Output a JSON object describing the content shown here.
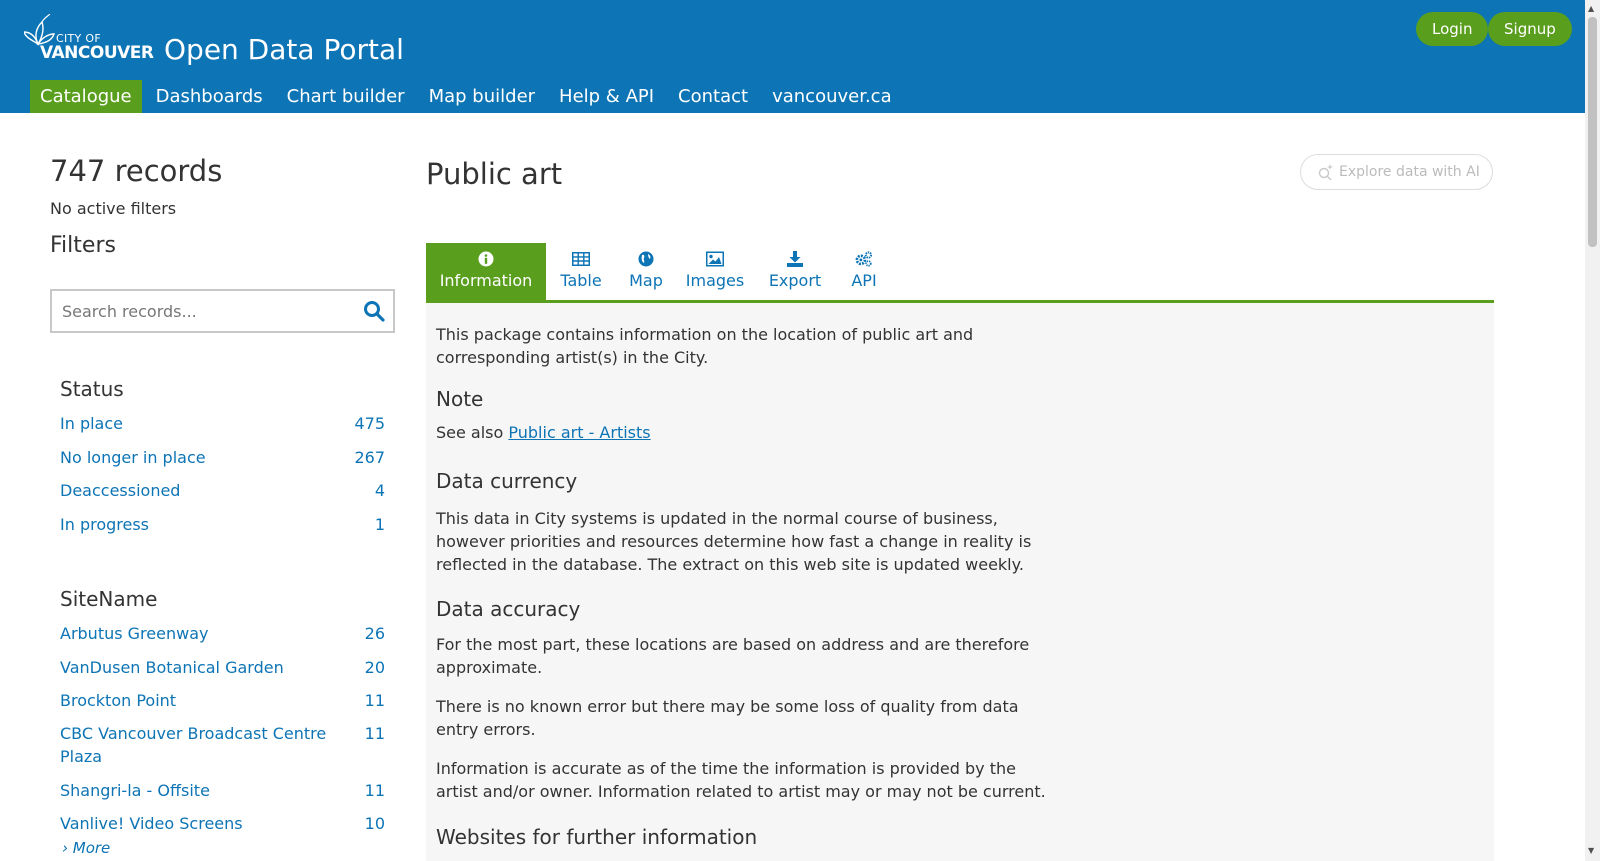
{
  "header": {
    "logo_small": "CITY OF",
    "logo_big": "VANCOUVER",
    "site_title": "Open Data Portal",
    "login": "Login",
    "signup": "Signup",
    "nav": [
      "Catalogue",
      "Dashboards",
      "Chart builder",
      "Map builder",
      "Help & API",
      "Contact",
      "vancouver.ca"
    ]
  },
  "sidebar": {
    "records": "747 records",
    "active_filters": "No active filters",
    "filters_title": "Filters",
    "search_placeholder": "Search records...",
    "status": {
      "title": "Status",
      "items": [
        {
          "label": "In place",
          "count": "475"
        },
        {
          "label": "No longer in place",
          "count": "267"
        },
        {
          "label": "Deaccessioned",
          "count": "4"
        },
        {
          "label": "In progress",
          "count": "1"
        }
      ]
    },
    "sitename": {
      "title": "SiteName",
      "items": [
        {
          "label": "Arbutus Greenway",
          "count": "26"
        },
        {
          "label": "VanDusen Botanical Garden",
          "count": "20"
        },
        {
          "label": "Brockton Point",
          "count": "11"
        },
        {
          "label": "CBC Vancouver Broadcast Centre Plaza",
          "count": "11"
        },
        {
          "label": "Shangri-la - Offsite",
          "count": "11"
        },
        {
          "label": "Vanlive! Video Screens",
          "count": "10"
        }
      ],
      "more": "› More"
    }
  },
  "main": {
    "title": "Public art",
    "ai_button": "Explore data with AI",
    "tabs": [
      "Information",
      "Table",
      "Map",
      "Images",
      "Export",
      "API"
    ],
    "intro": "This package contains information on the location of public art and corresponding artist(s) in the City.",
    "note_title": "Note",
    "note_prefix": "See also ",
    "note_link": "Public art - Artists",
    "currency_title": "Data currency",
    "currency_text": "This data in City systems is updated in the normal course of business, however priorities and resources determine how fast a change in reality is reflected in the database. The extract on this web site is updated weekly.",
    "accuracy_title": "Data accuracy",
    "accuracy_p1": "For the most part, these locations are based on address and are therefore approximate.",
    "accuracy_p2": "There is no known error but there may be some loss of quality from data entry errors.",
    "accuracy_p3": "Information is accurate as of the time the information is provided by the artist and/or owner. Information related to artist may or may not be current.",
    "websites_title": "Websites for further information"
  },
  "colors": {
    "header_blue": "#0d74b5",
    "accent_green": "#5a9e1e",
    "link_blue": "#0d74b5",
    "content_bg": "#f6f6f6"
  },
  "icons": [
    "logo-flower-icon",
    "search-icon",
    "ai-sparkle-icon",
    "info-icon",
    "table-icon",
    "globe-icon",
    "image-icon",
    "download-icon",
    "gears-icon"
  ]
}
